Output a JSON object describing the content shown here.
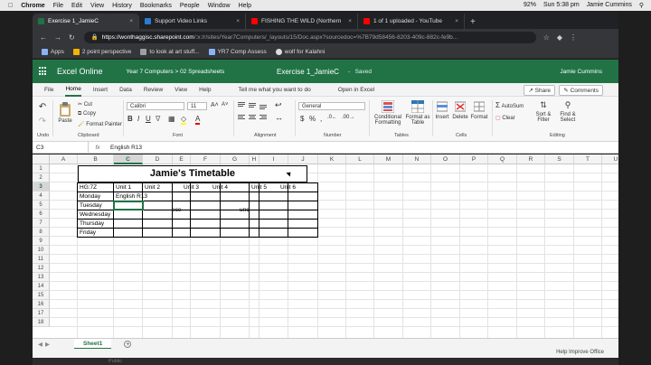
{
  "mac_menu": {
    "app": "Chrome",
    "items": [
      "File",
      "Edit",
      "View",
      "History",
      "Bookmarks",
      "People",
      "Window",
      "Help"
    ],
    "battery": "92%",
    "clock": "Sun 5:38 pm",
    "user": "Jamie Cummins"
  },
  "tabs": [
    {
      "title": "Exercise 1_JamieC",
      "icon_color": "#217346",
      "active": true
    },
    {
      "title": "Support Video Links",
      "icon_color": "#2b7cd3",
      "active": false
    },
    {
      "title": "FISHING THE WILD (Northern",
      "icon_color": "#ff0000",
      "active": false
    },
    {
      "title": "1 of 1 uploaded - YouTube",
      "icon_color": "#ff0000",
      "active": false
    }
  ],
  "omnibox": {
    "host": "https://wonthaggisc.sharepoint.com",
    "path": "/:x:/r/sites/Year7Computers/_layouts/15/Doc.aspx?sourcedoc=%7B79d58456-8203-409c-882c-fe9b..."
  },
  "bookmarks": [
    "Apps",
    "2 point perspective",
    "to look at art stuff...",
    "YR7 Comp Assess",
    "wolf for Kalahni"
  ],
  "excel": {
    "app_name": "Excel Online",
    "breadcrumb": "Year 7 Computers  >  02 Spreadsheets",
    "doc_title": "Exercise 1_JamieC",
    "save_sep": "-",
    "save_state": "Saved",
    "user": "Jamie Cummins"
  },
  "ribbon_tabs": [
    "File",
    "Home",
    "Insert",
    "Data",
    "Review",
    "View",
    "Help"
  ],
  "active_ribbon_tab": "Home",
  "tell_me": "Tell me what you want to do",
  "open_in_excel": "Open in Excel",
  "share": "Share",
  "comments": "Comments",
  "ribbon": {
    "undo": "Undo",
    "paste": "Paste",
    "cut": "Cut",
    "copy": "Copy",
    "format_painter": "Format Painter",
    "clipboard": "Clipboard",
    "font_name": "Calibri",
    "font_size": "11",
    "font_group": "Font",
    "alignment_group": "Alignment",
    "number_format": "General",
    "number_group": "Number",
    "conditional_formatting": "Conditional Formatting",
    "format_as_table": "Format as Table",
    "tables_group": "Tables",
    "insert": "Insert",
    "delete": "Delete",
    "format": "Format",
    "cells_group": "Cells",
    "autosum": "AutoSum",
    "clear": "Clear",
    "sort_filter": "Sort & Filter",
    "find_select": "Find & Select",
    "editing_group": "Editing"
  },
  "formula_bar": {
    "name_box": "C3",
    "fx": "fx",
    "value": "English R13"
  },
  "columns": [
    "A",
    "B",
    "C",
    "D",
    "E",
    "F",
    "G",
    "H",
    "I",
    "J",
    "K",
    "L",
    "M",
    "N",
    "O",
    "P",
    "Q",
    "R",
    "S",
    "T",
    "U"
  ],
  "rows": [
    "1",
    "2",
    "3",
    "4",
    "5",
    "6",
    "7",
    "8",
    "9",
    "10",
    "11",
    "12",
    "13",
    "14",
    "15",
    "16",
    "17",
    "18"
  ],
  "selected_cell": "C3",
  "sheet": {
    "title": "Jamie's Timetable",
    "class": "HG:7Z",
    "unit_headers": [
      "Unit 1",
      "Unit 2",
      "Unit 3",
      "Unit 4",
      "Unit 5",
      "Unit 6"
    ],
    "days": [
      "Monday",
      "Tuesday",
      "Wednesday",
      "Thursday",
      "Friday"
    ],
    "monday_unit1": "English R13",
    "recess": "ece",
    "lunch": "unc"
  },
  "sheet_tab": "Sheet1",
  "status": "Help Improve Office",
  "below_strip": "Public"
}
